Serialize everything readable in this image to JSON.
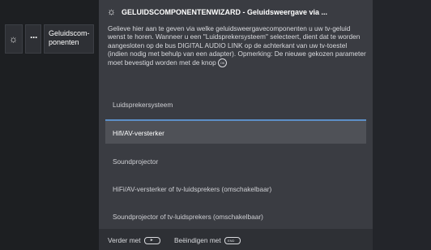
{
  "breadcrumb": {
    "gear_glyph": "☼",
    "dots_glyph": "···",
    "label": "Geluidscom-ponenten"
  },
  "dialog": {
    "title_icon": "☼",
    "title": "GELUIDSCOMPONENTENWIZARD - Geluidsweergave via ...",
    "description": "Gelieve hier aan te geven via welke geluidsweergavecomponenten u uw tv-geluid wenst te horen. Wanneer u een \"Luidsprekersysteem\" selecteert, dient dat te worden aangesloten op de bus DIGITAL AUDIO LINK op de achterkant van uw tv-toestel (indien nodig met behulp van een adapter). Opmerking: De nieuwe gekozen parameter moet bevestigd worden met de knop",
    "ok_badge": "OK",
    "options": [
      {
        "label": "Luidsprekersysteem",
        "selected": false
      },
      {
        "label": "Hifi/AV-versterker",
        "selected": true
      },
      {
        "label": "Soundprojector",
        "selected": false
      },
      {
        "label": "HiFi/AV-versterker of tv-luidsprekers (omschakelbaar)",
        "selected": false
      },
      {
        "label": "Soundprojector of tv-luidsprekers (omschakelbaar)",
        "selected": false
      }
    ],
    "footer": {
      "next_label": "Verder met",
      "end_label": "Beëindigen met",
      "next_key_glyph": "►",
      "end_key_glyph": "END"
    }
  },
  "colors": {
    "selection_accent": "#5c8fc7",
    "dialog_bg": "#3a3c42",
    "selected_bg": "#4f5157"
  }
}
